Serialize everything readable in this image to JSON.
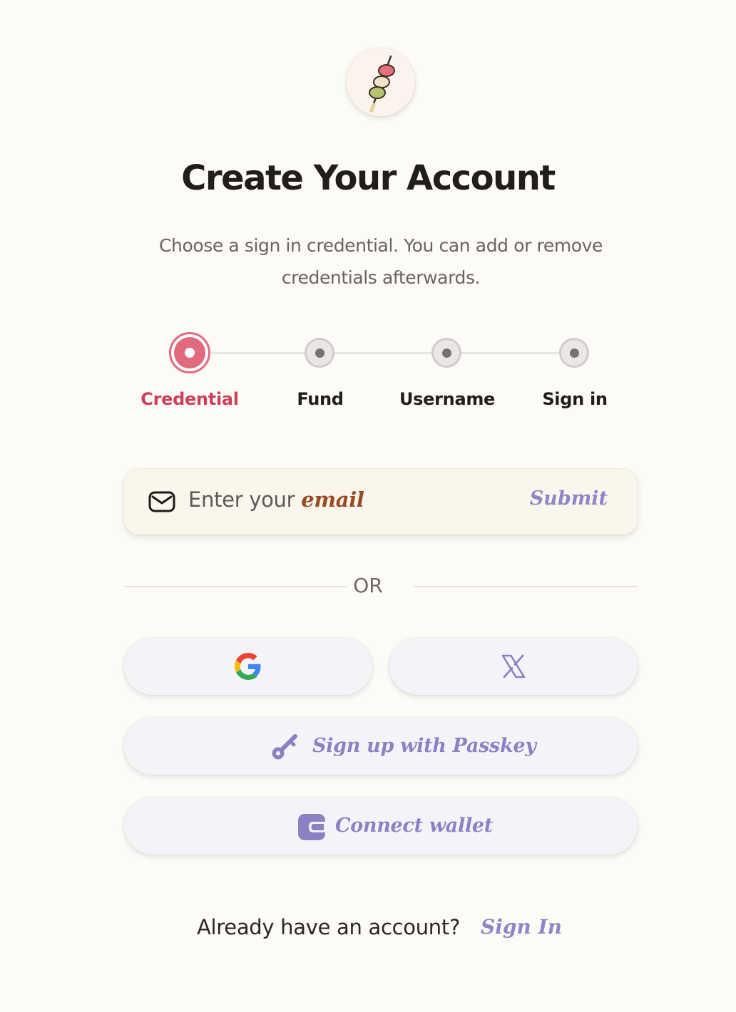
{
  "header": {
    "logo_icon": "dango-skewer-icon",
    "title": "Create Your Account",
    "subtitle": "Choose a sign in credential. You can add or remove credentials afterwards."
  },
  "stepper": {
    "steps": [
      {
        "label": "Credential",
        "state": "active"
      },
      {
        "label": "Fund",
        "state": "pending"
      },
      {
        "label": "Username",
        "state": "pending"
      },
      {
        "label": "Sign in",
        "state": "pending"
      }
    ]
  },
  "email": {
    "icon": "mail-icon",
    "placeholder_prefix": "Enter your ",
    "placeholder_emphasis": "email",
    "submit_label": "Submit"
  },
  "divider": {
    "label": "OR"
  },
  "social": {
    "google_icon": "google-icon",
    "x_icon": "x-icon",
    "passkey_label": "Sign up with Passkey",
    "passkey_icon": "key-icon",
    "wallet_label": "Connect wallet",
    "wallet_icon": "wallet-icon"
  },
  "footer": {
    "prompt": "Already have an account?",
    "link": "Sign In"
  },
  "colors": {
    "background": "#fdfbf6",
    "accent_active": "#cd3f5a",
    "accent_link": "#8f86c9",
    "email_emphasis": "#9a4a24"
  }
}
